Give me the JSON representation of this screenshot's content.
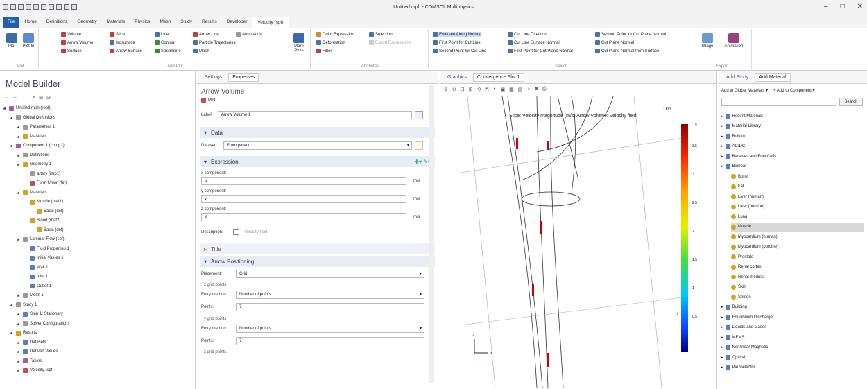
{
  "title_bar": {
    "title": "Untitled.mph - COMSOL Multiphysics"
  },
  "tabs": [
    "File",
    "Home",
    "Definitions",
    "Geometry",
    "Materials",
    "Physics",
    "Mesh",
    "Study",
    "Results",
    "Developer",
    "Velocity (spf)"
  ],
  "ribbon": {
    "plot_group": {
      "plot": "Plot",
      "plot_in": "Plot In",
      "label": "Plot"
    },
    "add_plot": {
      "items": [
        "Volume",
        "Slice",
        "Line",
        "Arrow Line",
        "Annotation",
        "Arrow Volume",
        "Isosurface",
        "Contour",
        "Particle Trajectories",
        "Surface",
        "Arrow Surface",
        "Streamline",
        "Mesh"
      ],
      "more": "More Plots",
      "label": "Add Plot"
    },
    "attributes": {
      "items": [
        "Color Expression",
        "Selection",
        "Deformation",
        "Export Expressions",
        "Filter"
      ],
      "label": "Attributes"
    },
    "select": {
      "items": [
        "Evaluate Along Normal",
        "Cut Line Direction",
        "Second Point for Cut Plane Normal",
        "First Point for Cut Line",
        "Cut Line Surface Normal",
        "Cut Plane Normal",
        "Second Point for Cut Line",
        "First Point for Cut Plane Normal",
        "Cut Plane Normal from Surface"
      ],
      "label": "Select"
    },
    "export": {
      "image": "Image",
      "animation": "Animation",
      "label": "Export"
    }
  },
  "model_builder": {
    "title": "Model Builder",
    "tree": [
      {
        "label": "Untitled.mph (root)",
        "level": 0
      },
      {
        "label": "Global Definitions",
        "level": 1
      },
      {
        "label": "Parameters 1",
        "level": 2
      },
      {
        "label": "Materials",
        "level": 2
      },
      {
        "label": "Component 1 (comp1)",
        "level": 1
      },
      {
        "label": "Definitions",
        "level": 2
      },
      {
        "label": "Geometry 1",
        "level": 2
      },
      {
        "label": "artery (imp1)",
        "level": 3
      },
      {
        "label": "Form Union (fin)",
        "level": 3
      },
      {
        "label": "Materials",
        "level": 2
      },
      {
        "label": "Muscle (mat1)",
        "level": 3
      },
      {
        "label": "Basic (def)",
        "level": 4
      },
      {
        "label": "Blood (mat2)",
        "level": 3
      },
      {
        "label": "Basic (def)",
        "level": 4
      },
      {
        "label": "Laminar Flow (spf)",
        "level": 2
      },
      {
        "label": "Fluid Properties 1",
        "level": 3
      },
      {
        "label": "Initial Values 1",
        "level": 3
      },
      {
        "label": "Wall 1",
        "level": 3
      },
      {
        "label": "Inlet 1",
        "level": 3
      },
      {
        "label": "Outlet 1",
        "level": 3
      },
      {
        "label": "Mesh 1",
        "level": 2
      },
      {
        "label": "Study 1",
        "level": 1
      },
      {
        "label": "Step 1: Stationary",
        "level": 2
      },
      {
        "label": "Solver Configurations",
        "level": 2
      },
      {
        "label": "Results",
        "level": 1
      },
      {
        "label": "Datasets",
        "level": 2
      },
      {
        "label": "Derived Values",
        "level": 2
      },
      {
        "label": "Tables",
        "level": 2
      },
      {
        "label": "Velocity (spf)",
        "level": 2
      }
    ]
  },
  "settings": {
    "tabs": [
      "Settings",
      "Properties"
    ],
    "heading": "Arrow Volume",
    "subheading": "Plot",
    "label_field": {
      "label": "Label:",
      "value": "Arrow Volume 1"
    },
    "data_section": "Data",
    "dataset": {
      "label": "Dataset:",
      "value": "From parent"
    },
    "expression_section": "Expression",
    "x_component": {
      "label": "x component:",
      "value": "u",
      "unit": "m/s"
    },
    "y_component": {
      "label": "y component:",
      "value": "v",
      "unit": "m/s"
    },
    "z_component": {
      "label": "z component:",
      "value": "w",
      "unit": "m/s"
    },
    "description": {
      "label": "Description:",
      "value": "Velocity field"
    },
    "title_section": "Title",
    "arrow_positioning_section": "Arrow Positioning",
    "placement": {
      "label": "Placement:",
      "value": "Grid"
    },
    "x_grid": "x grid points",
    "entry_method_x": {
      "label": "Entry method:",
      "value": "Number of points"
    },
    "points_x": {
      "label": "Points:",
      "value": "7"
    },
    "y_grid": "y grid points",
    "entry_method_y": {
      "label": "Entry method:",
      "value": "Number of points"
    },
    "points_y": {
      "label": "Points:",
      "value": "7"
    },
    "z_grid": "z grid points"
  },
  "graphics": {
    "tabs": [
      "Graphics",
      "Convergence Plot 1"
    ],
    "plot_title": "Slice: Velocity magnitude (m/s) Arrow Volume: Velocity field",
    "top_value": "0.05",
    "colorbar_ticks": [
      "3.5",
      "3",
      "2.5",
      "2",
      "1.5",
      "1",
      "0.5"
    ],
    "colorbar_extra": [
      "4",
      "0"
    ],
    "axis_z": "z",
    "axis_x": "x"
  },
  "materials": {
    "tabs": [
      "Add Study",
      "Add Material"
    ],
    "add_global": "Add to Global Materials",
    "add_component": "Add to Component",
    "search_button": "Search",
    "tree": [
      {
        "label": "Recent Materials",
        "level": 0
      },
      {
        "label": "Material Library",
        "level": 0
      },
      {
        "label": "Built-in",
        "level": 0
      },
      {
        "label": "AC/DC",
        "level": 0
      },
      {
        "label": "Batteries and Fuel Cells",
        "level": 0
      },
      {
        "label": "Bioheat",
        "level": 0
      },
      {
        "label": "Bone",
        "level": 1
      },
      {
        "label": "Fat",
        "level": 1
      },
      {
        "label": "Liver (human)",
        "level": 1
      },
      {
        "label": "Liver (porcine)",
        "level": 1
      },
      {
        "label": "Lung",
        "level": 1
      },
      {
        "label": "Muscle",
        "level": 1,
        "selected": true
      },
      {
        "label": "Myocardium (human)",
        "level": 1
      },
      {
        "label": "Myocardium (porcine)",
        "level": 1
      },
      {
        "label": "Prostate",
        "level": 1
      },
      {
        "label": "Renal cortex",
        "level": 1
      },
      {
        "label": "Renal medulla",
        "level": 1
      },
      {
        "label": "Skin",
        "level": 1
      },
      {
        "label": "Spleen",
        "level": 1
      },
      {
        "label": "Building",
        "level": 0
      },
      {
        "label": "Equilibrium Discharge",
        "level": 0
      },
      {
        "label": "Liquids and Gases",
        "level": 0
      },
      {
        "label": "MEMS",
        "level": 0
      },
      {
        "label": "Nonlinear Magnetic",
        "level": 0
      },
      {
        "label": "Optical",
        "level": 0
      },
      {
        "label": "Piezoelectric",
        "level": 0
      }
    ]
  }
}
